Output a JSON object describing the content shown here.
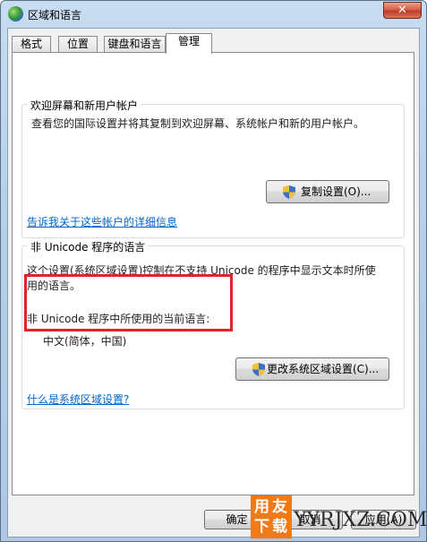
{
  "window": {
    "title": "区域和语言",
    "close_label": "✕"
  },
  "tabs": [
    "格式",
    "位置",
    "键盘和语言",
    "管理"
  ],
  "welcome": {
    "title": "欢迎屏幕和新用户帐户",
    "description": "查看您的国际设置并将其复制到欢迎屏幕、系统帐户和新的用户帐户。",
    "copy_button": "复制设置(O)...",
    "link": "告诉我关于这些帐户的详细信息"
  },
  "unicode": {
    "title": "非 Unicode 程序的语言",
    "description_line1": "这个设置(系统区域设置)控制在不支持 Unicode 的程序中显示文本时所使",
    "description_line2": "用的语言。",
    "current_label": "非 Unicode 程序中所使用的当前语言:",
    "current_value": "中文(简体，中国)",
    "change_button": "更改系统区域设置(C)...",
    "link": "什么是系统区域设置?"
  },
  "footer": {
    "ok": "确定",
    "cancel": "取消",
    "apply": "应用(A)"
  },
  "watermark": {
    "chars": [
      "用",
      "友",
      "下",
      "载"
    ],
    "site": "YYRJXZ.COM"
  },
  "colors": {
    "highlight": "#e0242a",
    "link": "#0066cc",
    "watermark": "#f07a18"
  }
}
